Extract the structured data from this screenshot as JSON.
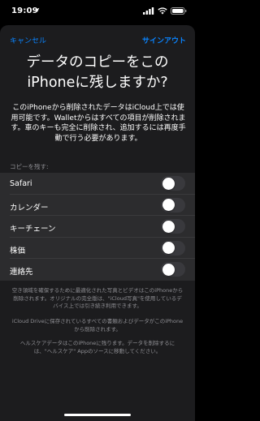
{
  "status_bar": {
    "time": "19:09",
    "location_icon": "location-arrow-icon",
    "signal_icon": "cellular-signal-icon",
    "wifi_icon": "wifi-icon",
    "battery_icon": "battery-icon"
  },
  "nav": {
    "cancel_label": "キャンセル",
    "sign_out_label": "サインアウト"
  },
  "title": "データのコピーをこの\niPhoneに残しますか?",
  "description": "このiPhoneから削除されたデータはiCloud上では使用可能です。Walletからはすべての項目が削除されます。車のキーも完全に削除され、追加するには再度手動で行う必要があります。",
  "section_header": "コピーを残す:",
  "options": [
    {
      "label": "Safari",
      "enabled": false
    },
    {
      "label": "カレンダー",
      "enabled": false
    },
    {
      "label": "キーチェーン",
      "enabled": false
    },
    {
      "label": "株価",
      "enabled": false
    },
    {
      "label": "連絡先",
      "enabled": false
    }
  ],
  "footer": {
    "storage_note": "空き領域を確保するために最適化された写真とビデオはこのiPhoneから削除されます。オリジナルの完全版は、\"iCloud写真\"を使用しているデバイス上では引き続き利用できます。",
    "icloud_drive_note": "iCloud Driveに保存されているすべての書類およびデータがこのiPhoneから削除されます。",
    "health_note": "ヘルスケアデータはこのiPhoneに残ります。データを削除するには、\"ヘルスケア\" Appのソースに移動してください。"
  },
  "colors": {
    "accent": "#0a84ff",
    "sheet_background": "#1c1c1e",
    "row_background": "#2c2c2e",
    "toggle_off": "#39393d",
    "secondary_text": "#8e8e93"
  }
}
